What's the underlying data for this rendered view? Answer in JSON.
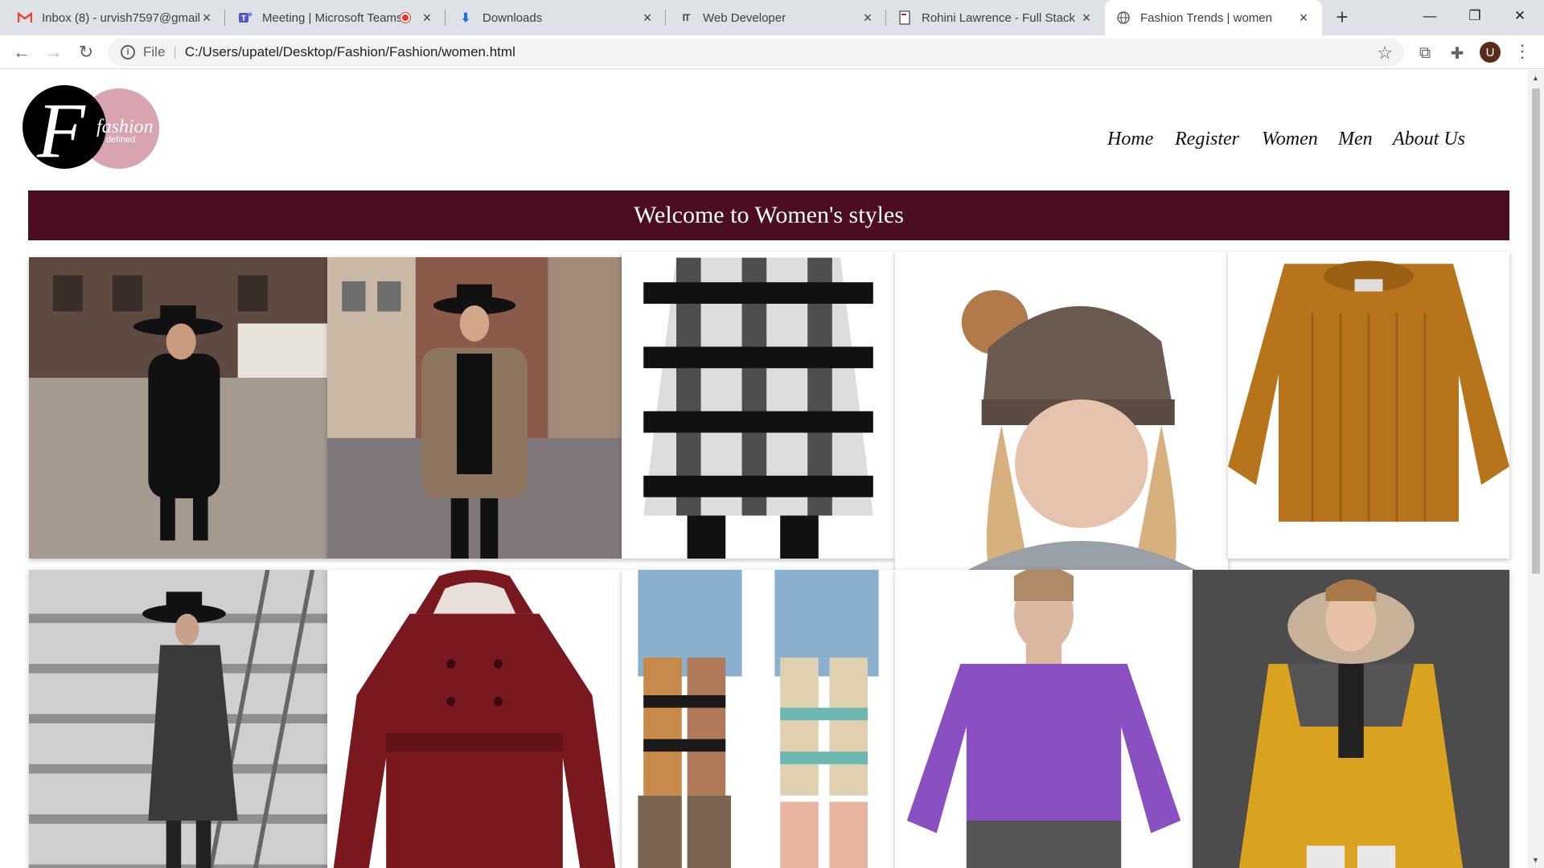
{
  "browser": {
    "tabs": [
      {
        "title": "Inbox (8) - urvish7597@gmail.com",
        "icon": "gmail-icon"
      },
      {
        "title": "Meeting | Microsoft Teams",
        "icon": "teams-icon"
      },
      {
        "title": "Downloads",
        "icon": "download-icon"
      },
      {
        "title": "Web Developer",
        "icon": "web-dev-icon"
      },
      {
        "title": "Rohini Lawrence - Full Stack Developer",
        "icon": "document-icon"
      },
      {
        "title": "Fashion Trends | women",
        "icon": "globe-icon"
      }
    ],
    "active_tab": 5,
    "address": {
      "scheme": "File",
      "path": "C:/Users/upatel/Desktop/Fashion/Fashion/women.html"
    },
    "profile_initial": "U"
  },
  "site": {
    "logo": {
      "letter": "F",
      "word": "fashion",
      "sub": "defined",
      "colors": {
        "dark": "#000000",
        "accent": "#d9a4b2"
      }
    },
    "nav": [
      "Home",
      "Register",
      "Women",
      "Men",
      "About Us"
    ],
    "banner": {
      "title": "Welcome to Women's styles",
      "color": "#4a0d22"
    }
  },
  "gallery": [
    {
      "subject": "Woman in black coat and wide-brim hat"
    },
    {
      "subject": "Woman in leopard print coat and black hat"
    },
    {
      "subject": "Black and white checked dress"
    },
    {
      "subject": "Woman in brown knit beanie with pom-pom"
    },
    {
      "subject": "Mustard knit oversized sweater"
    },
    {
      "subject": "Woman in grey long coat on stairs"
    },
    {
      "subject": "Burgundy hooded belted coat"
    },
    {
      "subject": "Patterned knit leg warmers with boots"
    },
    {
      "subject": "Woman in purple sweatshirt"
    },
    {
      "subject": "Man in yellow hooded parka"
    }
  ]
}
